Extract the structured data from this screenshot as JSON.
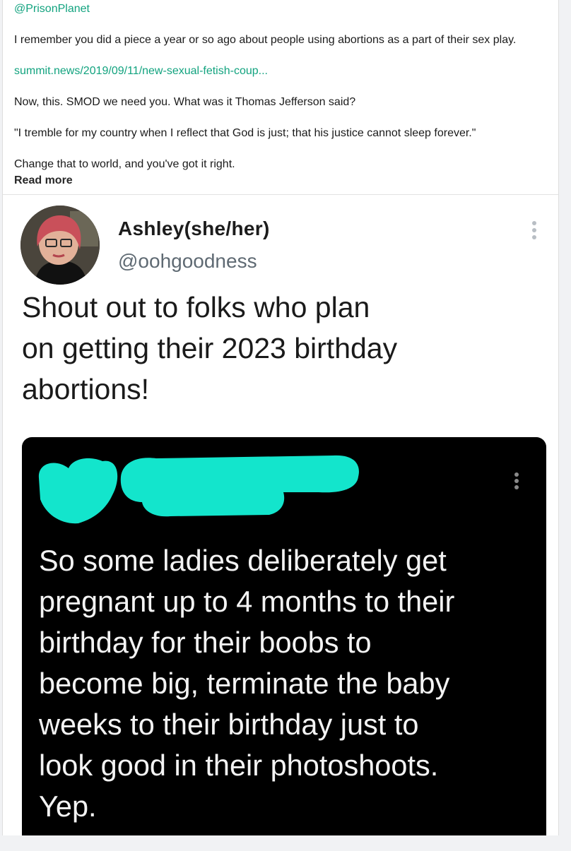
{
  "post": {
    "mention": "@PrisonPlanet",
    "paragraph1": "I remember you did a piece a year or so ago about people using abortions as a part of their sex play.",
    "link": "summit.news/2019/09/11/new-sexual-fetish-coup...",
    "paragraph2": "Now, this. SMOD we need you. What was it Thomas Jefferson said?",
    "quote": "\"I tremble for my country when I reflect that God is just; that his justice cannot sleep forever.\"",
    "paragraph3": "Change that to world, and you've got it right.",
    "read_more": "Read more"
  },
  "tweet": {
    "author_name": "Ashley(she/her)",
    "author_handle": "@oohgoodness",
    "text": "Shout out to folks who plan\non getting their 2023 birthday\nabortions!",
    "embedded": {
      "text": "So some ladies deliberately get\npregnant up to 4 months to their\nbirthday for their boobs to\nbecome big, terminate the baby\nweeks to their birthday just to\nlook good in their photoshoots.\nYep."
    }
  },
  "colors": {
    "link": "#12a37f",
    "redaction": "#13e5cc",
    "dark_card": "#000000"
  },
  "icons": [
    "more-vertical-icon",
    "avatar-photo"
  ]
}
